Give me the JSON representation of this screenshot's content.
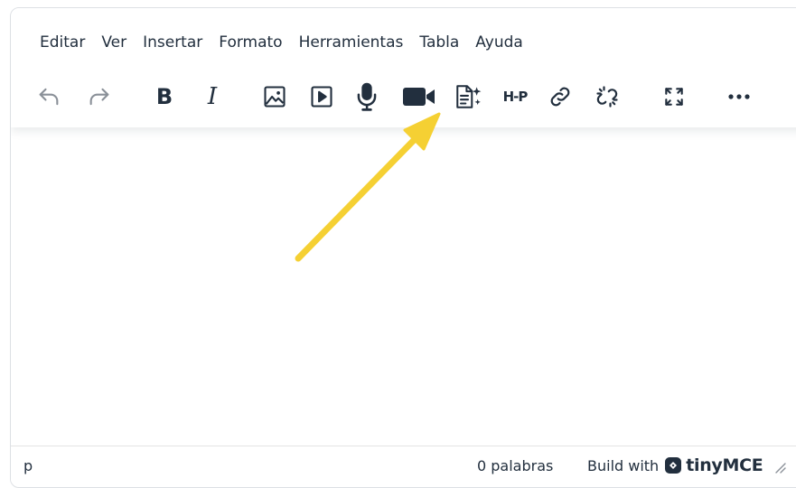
{
  "menubar": {
    "items": [
      {
        "key": "edit",
        "label": "Editar"
      },
      {
        "key": "view",
        "label": "Ver"
      },
      {
        "key": "insert",
        "label": "Insertar"
      },
      {
        "key": "format",
        "label": "Formato"
      },
      {
        "key": "tools",
        "label": "Herramientas"
      },
      {
        "key": "table",
        "label": "Tabla"
      },
      {
        "key": "help",
        "label": "Ayuda"
      }
    ]
  },
  "toolbar": {
    "icons": [
      {
        "key": "undo",
        "icon": "undo-icon",
        "enabled": false
      },
      {
        "key": "redo",
        "icon": "redo-icon",
        "enabled": false
      },
      {
        "key": "bold",
        "icon": "bold-icon",
        "enabled": true
      },
      {
        "key": "italic",
        "icon": "italic-icon",
        "enabled": true
      },
      {
        "key": "image",
        "icon": "image-icon",
        "enabled": true
      },
      {
        "key": "media",
        "icon": "media-play-icon",
        "enabled": true
      },
      {
        "key": "record-audio",
        "icon": "microphone-icon",
        "enabled": true
      },
      {
        "key": "record-video",
        "icon": "video-camera-icon",
        "enabled": true
      },
      {
        "key": "ai-document",
        "icon": "document-sparkle-icon",
        "enabled": true
      },
      {
        "key": "h5p",
        "icon": "h5p-icon",
        "enabled": true
      },
      {
        "key": "link",
        "icon": "link-icon",
        "enabled": true
      },
      {
        "key": "unlink",
        "icon": "unlink-icon",
        "enabled": true
      },
      {
        "key": "fullscreen",
        "icon": "fullscreen-icon",
        "enabled": true
      },
      {
        "key": "more",
        "icon": "more-icon",
        "enabled": true
      }
    ],
    "bold_glyph": "B",
    "italic_glyph": "I",
    "h5p_text": "H-P"
  },
  "statusbar": {
    "path": "p",
    "wordcount": "0 palabras",
    "branding_prefix": "Build with",
    "branding_name": "tinyMCE"
  },
  "annotation": {
    "icon": "arrow-pointer",
    "color": "#f5d033"
  },
  "colors": {
    "text": "#222f3e",
    "disabled": "#8a9098",
    "border": "#dde0e4"
  }
}
